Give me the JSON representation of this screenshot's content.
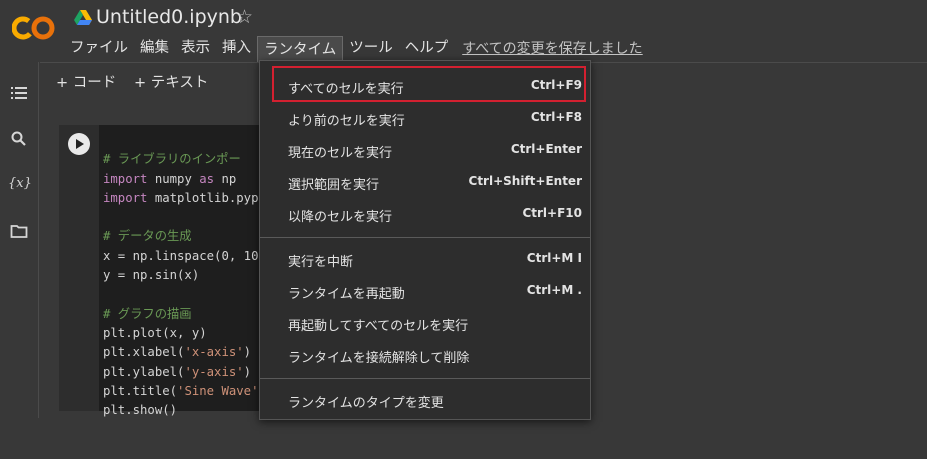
{
  "app": {
    "logo": "CO",
    "title": "Untitled0.ipynb",
    "drive_icon": "google-drive-icon",
    "star_icon": "☆"
  },
  "menu": {
    "items": [
      "ファイル",
      "編集",
      "表示",
      "挿入",
      "ランタイム",
      "ツール",
      "ヘルプ"
    ],
    "active": "ランタイム",
    "saved_status": "すべての変更を保存しました"
  },
  "toolbar": {
    "add_code": "+ コード",
    "add_text": "+ テキスト"
  },
  "sidebar": {
    "icons": [
      "table-of-contents-icon",
      "search-icon",
      "variables-icon",
      "folder-icon"
    ],
    "variables_glyph": "{x}"
  },
  "cell": {
    "lines": [
      "# ライブラリのインポー",
      "import numpy as np",
      "import matplotlib.pypl",
      "",
      "# データの生成",
      "x = np.linspace(0, 10,",
      "y = np.sin(x)",
      "",
      "# グラフの描画",
      "plt.plot(x, y)",
      "plt.xlabel('x-axis')",
      "plt.ylabel('y-axis')",
      "plt.title('Sine Wave')",
      "plt.show()"
    ]
  },
  "runtime_menu": {
    "groups": [
      [
        {
          "label": "すべてのセルを実行",
          "shortcut": "Ctrl+F9"
        },
        {
          "label": "より前のセルを実行",
          "shortcut": "Ctrl+F8"
        },
        {
          "label": "現在のセルを実行",
          "shortcut": "Ctrl+Enter"
        },
        {
          "label": "選択範囲を実行",
          "shortcut": "Ctrl+Shift+Enter"
        },
        {
          "label": "以降のセルを実行",
          "shortcut": "Ctrl+F10"
        }
      ],
      [
        {
          "label": "実行を中断",
          "shortcut": "Ctrl+M I"
        },
        {
          "label": "ランタイムを再起動",
          "shortcut": "Ctrl+M ."
        },
        {
          "label": "再起動してすべてのセルを実行",
          "shortcut": ""
        },
        {
          "label": "ランタイムを接続解除して削除",
          "shortcut": ""
        }
      ],
      [
        {
          "label": "ランタイムのタイプを変更",
          "shortcut": ""
        }
      ]
    ],
    "highlighted": "すべてのセルを実行",
    "highlight_color": "#d32030"
  },
  "colors": {
    "background": "#383838",
    "code_bg": "#1e1e1e",
    "menu_bg": "#2d2d2d",
    "logo_orange": "#f9ab00",
    "logo_dark_orange": "#e8710a"
  }
}
